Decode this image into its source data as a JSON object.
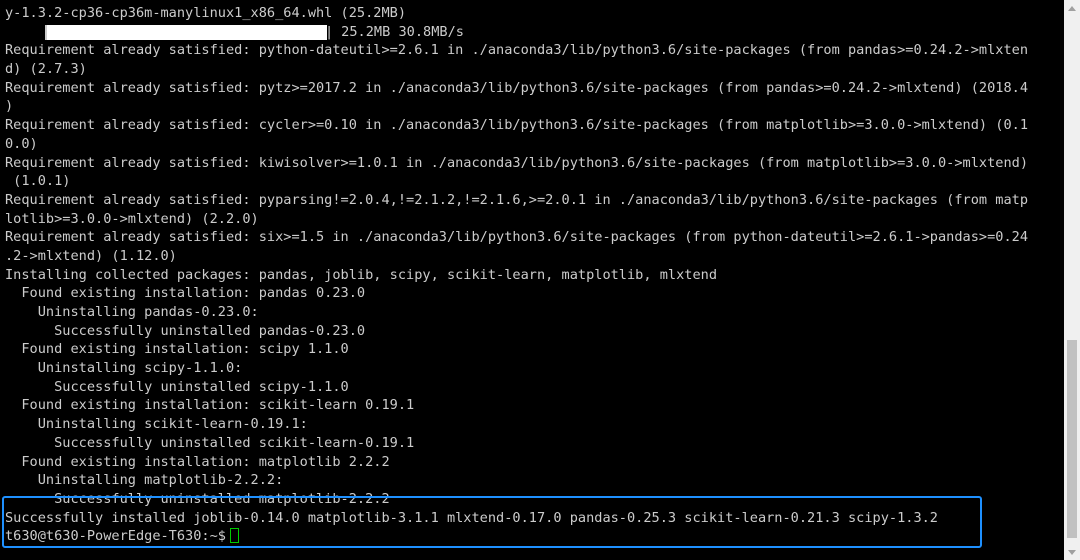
{
  "terminal": {
    "lines": [
      "y-1.3.2-cp36-cp36m-manylinux1_x86_64.whl (25.2MB)",
      "__PROGRESS__",
      "Requirement already satisfied: python-dateutil>=2.6.1 in ./anaconda3/lib/python3.6/site-packages (from pandas>=0.24.2->mlxten",
      "d) (2.7.3)",
      "Requirement already satisfied: pytz>=2017.2 in ./anaconda3/lib/python3.6/site-packages (from pandas>=0.24.2->mlxtend) (2018.4",
      ")",
      "Requirement already satisfied: cycler>=0.10 in ./anaconda3/lib/python3.6/site-packages (from matplotlib>=3.0.0->mlxtend) (0.1",
      "0.0)",
      "Requirement already satisfied: kiwisolver>=1.0.1 in ./anaconda3/lib/python3.6/site-packages (from matplotlib>=3.0.0->mlxtend)",
      " (1.0.1)",
      "Requirement already satisfied: pyparsing!=2.0.4,!=2.1.2,!=2.1.6,>=2.0.1 in ./anaconda3/lib/python3.6/site-packages (from matp",
      "lotlib>=3.0.0->mlxtend) (2.2.0)",
      "Requirement already satisfied: six>=1.5 in ./anaconda3/lib/python3.6/site-packages (from python-dateutil>=2.6.1->pandas>=0.24",
      ".2->mlxtend) (1.12.0)",
      "Installing collected packages: pandas, joblib, scipy, scikit-learn, matplotlib, mlxtend",
      "  Found existing installation: pandas 0.23.0",
      "    Uninstalling pandas-0.23.0:",
      "      Successfully uninstalled pandas-0.23.0",
      "  Found existing installation: scipy 1.1.0",
      "    Uninstalling scipy-1.1.0:",
      "      Successfully uninstalled scipy-1.1.0",
      "  Found existing installation: scikit-learn 0.19.1",
      "    Uninstalling scikit-learn-0.19.1:",
      "      Successfully uninstalled scikit-learn-0.19.1",
      "  Found existing installation: matplotlib 2.2.2",
      "    Uninstalling matplotlib-2.2.2:",
      "      Successfully uninstalled matplotlib-2.2.2",
      "Successfully installed joblib-0.14.0 matplotlib-3.1.1 mlxtend-0.17.0 pandas-0.25.3 scikit-learn-0.21.3 scipy-1.3.2"
    ],
    "progress": {
      "fraction": 1.0,
      "stats": "25.2MB 30.8MB/s"
    },
    "prompt": "t630@t630-PowerEdge-T630:~$",
    "colors": {
      "background": "#000000",
      "foreground": "#cccccc",
      "cursor": "#00cc00",
      "highlight": "#1e90ff",
      "scrollbar_track": "#f0f0f0",
      "scrollbar_thumb": "#c1c1c1"
    },
    "icons": {
      "scroll_up": "triangle-up-icon",
      "scroll_down": "triangle-down-icon"
    }
  }
}
